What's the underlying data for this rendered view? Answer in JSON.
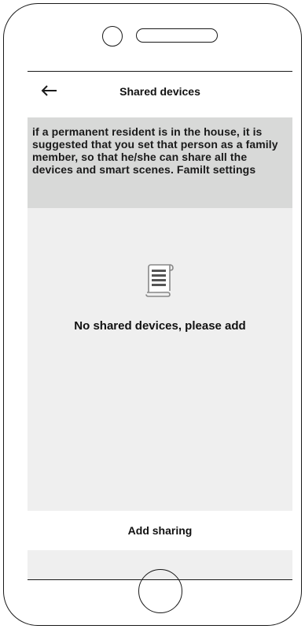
{
  "header": {
    "title": "Shared devices",
    "back_icon": "arrow-left-icon"
  },
  "notice": {
    "text": "if a permanent resident is in the house, it is suggested that you set that person as a family member, so that he/she can share all the devices and smart scenes. Familt settings"
  },
  "empty_state": {
    "icon": "document-scroll-icon",
    "text": "No shared devices, please add"
  },
  "footer": {
    "add_sharing_label": "Add sharing"
  },
  "colors": {
    "screen_background": "#efefef",
    "notice_background": "#d8d9d8",
    "bar_background": "#ffffff",
    "text": "#111111"
  }
}
